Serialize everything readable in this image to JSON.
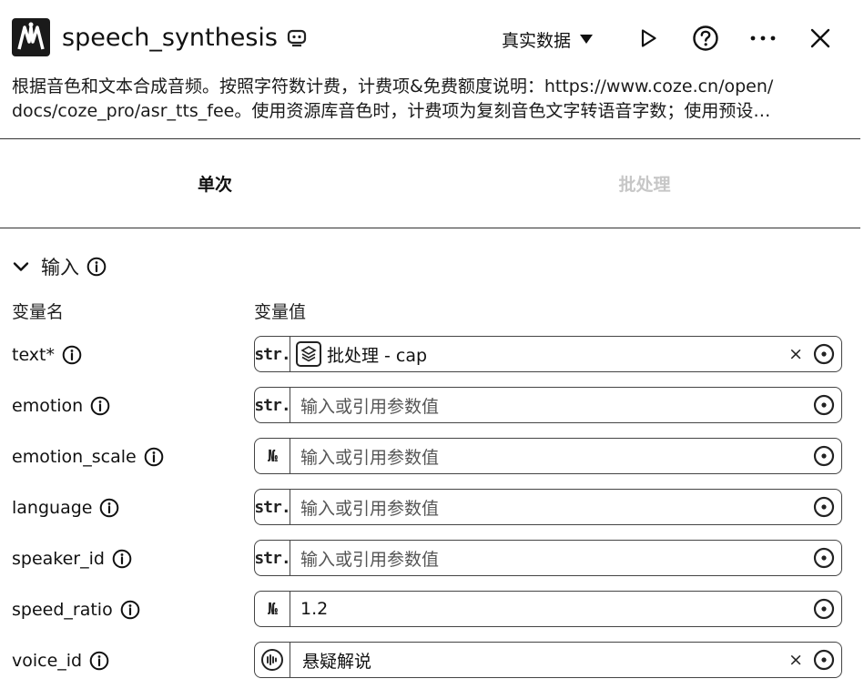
{
  "header": {
    "title": "speech_synthesis",
    "data_mode": "真实数据",
    "icons": [
      "plugin-logo-icon",
      "badge-icon",
      "play-icon",
      "help-icon",
      "more-icon",
      "close-icon"
    ]
  },
  "description": {
    "line1": "根据音色和文本合成音频。按照字符数计费，计费项&免费额度说明：https://www.coze.cn/open/",
    "line2": "docs/coze_pro/asr_tts_fee。使用资源库音色时，计费项为复刻音色文字转语音字数；使用预设…"
  },
  "tabs": [
    {
      "label": "单次",
      "active": true
    },
    {
      "label": "批处理",
      "active": false
    }
  ],
  "input_section": {
    "title": "输入",
    "col_name": "变量名",
    "col_value": "变量值",
    "rows": [
      {
        "name": "text*",
        "type": "str.",
        "value": "批处理 - cap",
        "placeholder": false
      },
      {
        "name": "emotion",
        "type": "str.",
        "value": "输入或引用参数值",
        "placeholder": true
      },
      {
        "name": "emotion_scale",
        "type": "№",
        "value": "输入或引用参数值",
        "placeholder": true
      },
      {
        "name": "language",
        "type": "str.",
        "value": "输入或引用参数值",
        "placeholder": true
      },
      {
        "name": "speaker_id",
        "type": "str.",
        "value": "输入或引用参数值",
        "placeholder": true
      },
      {
        "name": "speed_ratio",
        "type": "№",
        "value": "1.2",
        "placeholder": false
      },
      {
        "name": "voice_id",
        "type": "voice",
        "value": "悬疑解说",
        "placeholder": false
      }
    ],
    "clear_glyph": "×"
  }
}
